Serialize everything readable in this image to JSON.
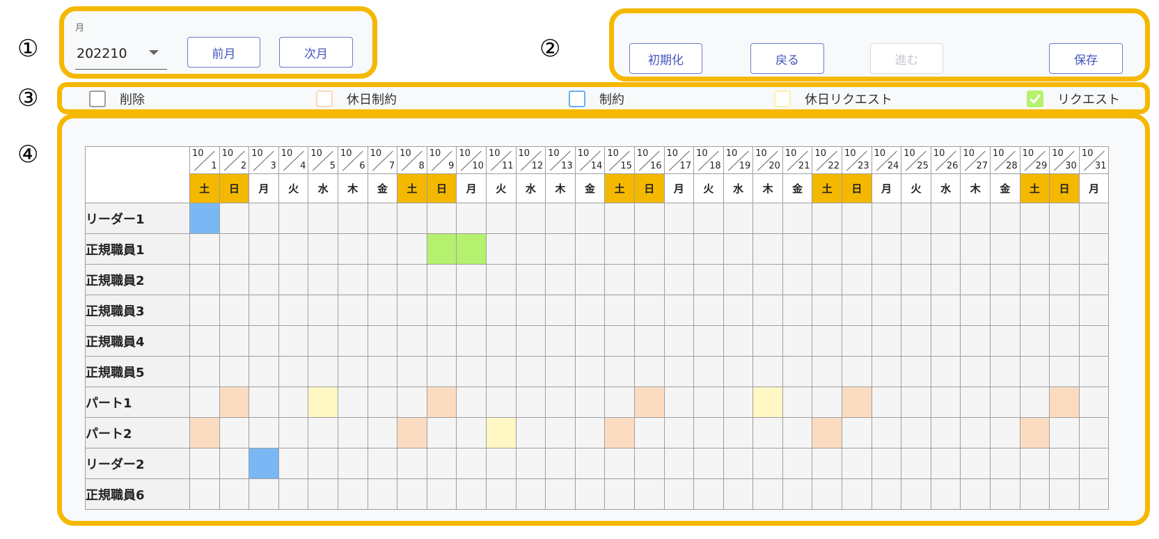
{
  "markers": [
    "①",
    "②",
    "③",
    "④"
  ],
  "controls": {
    "month_label": "月",
    "month_value": "202210",
    "prev_label": "前月",
    "next_label": "次月"
  },
  "actions": {
    "reset_label": "初期化",
    "undo_label": "戻る",
    "redo_label": "進む",
    "save_label": "保存"
  },
  "legend": [
    {
      "key": "delete",
      "label": "削除",
      "color": "#9e9e9e",
      "fill": false
    },
    {
      "key": "holiday-constraint",
      "label": "休日制約",
      "color": "#fcd7b8",
      "fill": false
    },
    {
      "key": "constraint",
      "label": "制約",
      "color": "#6aaef0",
      "fill": false
    },
    {
      "key": "holiday-request",
      "label": "休日リクエスト",
      "color": "#fdf0a8",
      "fill": false
    },
    {
      "key": "request",
      "label": "リクエスト",
      "color": "#b5f16e",
      "fill": true
    }
  ],
  "colors": {
    "accent": "#f5b800",
    "constraint": "#7ab8f5",
    "request": "#b5f16e",
    "holiday_constraint": "#fcdcc1",
    "holiday_request": "#fff8c4",
    "button": "#4355c0"
  },
  "calendar": {
    "month": "10",
    "days": [
      {
        "d": "1",
        "dow": "土",
        "weekend": true
      },
      {
        "d": "2",
        "dow": "日",
        "weekend": true
      },
      {
        "d": "3",
        "dow": "月",
        "weekend": false
      },
      {
        "d": "4",
        "dow": "火",
        "weekend": false
      },
      {
        "d": "5",
        "dow": "水",
        "weekend": false
      },
      {
        "d": "6",
        "dow": "木",
        "weekend": false
      },
      {
        "d": "7",
        "dow": "金",
        "weekend": false
      },
      {
        "d": "8",
        "dow": "土",
        "weekend": true
      },
      {
        "d": "9",
        "dow": "日",
        "weekend": true
      },
      {
        "d": "10",
        "dow": "月",
        "weekend": false
      },
      {
        "d": "11",
        "dow": "火",
        "weekend": false
      },
      {
        "d": "12",
        "dow": "水",
        "weekend": false
      },
      {
        "d": "13",
        "dow": "木",
        "weekend": false
      },
      {
        "d": "14",
        "dow": "金",
        "weekend": false
      },
      {
        "d": "15",
        "dow": "土",
        "weekend": true
      },
      {
        "d": "16",
        "dow": "日",
        "weekend": true
      },
      {
        "d": "17",
        "dow": "月",
        "weekend": false
      },
      {
        "d": "18",
        "dow": "火",
        "weekend": false
      },
      {
        "d": "19",
        "dow": "水",
        "weekend": false
      },
      {
        "d": "20",
        "dow": "木",
        "weekend": false
      },
      {
        "d": "21",
        "dow": "金",
        "weekend": false
      },
      {
        "d": "22",
        "dow": "土",
        "weekend": true
      },
      {
        "d": "23",
        "dow": "日",
        "weekend": true
      },
      {
        "d": "24",
        "dow": "月",
        "weekend": false
      },
      {
        "d": "25",
        "dow": "火",
        "weekend": false
      },
      {
        "d": "26",
        "dow": "水",
        "weekend": false
      },
      {
        "d": "27",
        "dow": "木",
        "weekend": false
      },
      {
        "d": "28",
        "dow": "金",
        "weekend": false
      },
      {
        "d": "29",
        "dow": "土",
        "weekend": true
      },
      {
        "d": "30",
        "dow": "日",
        "weekend": true
      },
      {
        "d": "31",
        "dow": "月",
        "weekend": false
      }
    ],
    "staff": [
      {
        "name": "リーダー1",
        "marks": {
          "1": "constraint"
        }
      },
      {
        "name": "正規職員1",
        "marks": {
          "9": "request",
          "10": "request"
        }
      },
      {
        "name": "正規職員2",
        "marks": {}
      },
      {
        "name": "正規職員3",
        "marks": {}
      },
      {
        "name": "正規職員4",
        "marks": {}
      },
      {
        "name": "正規職員5",
        "marks": {}
      },
      {
        "name": "パート1",
        "marks": {
          "2": "holiday-constraint",
          "5": "holiday-request",
          "9": "holiday-constraint",
          "16": "holiday-constraint",
          "20": "holiday-request",
          "23": "holiday-constraint",
          "30": "holiday-constraint"
        }
      },
      {
        "name": "パート2",
        "marks": {
          "1": "holiday-constraint",
          "8": "holiday-constraint",
          "11": "holiday-request",
          "15": "holiday-constraint",
          "22": "holiday-constraint",
          "29": "holiday-constraint"
        }
      },
      {
        "name": "リーダー2",
        "marks": {
          "3": "constraint"
        }
      },
      {
        "name": "正規職員6",
        "marks": {}
      }
    ]
  }
}
